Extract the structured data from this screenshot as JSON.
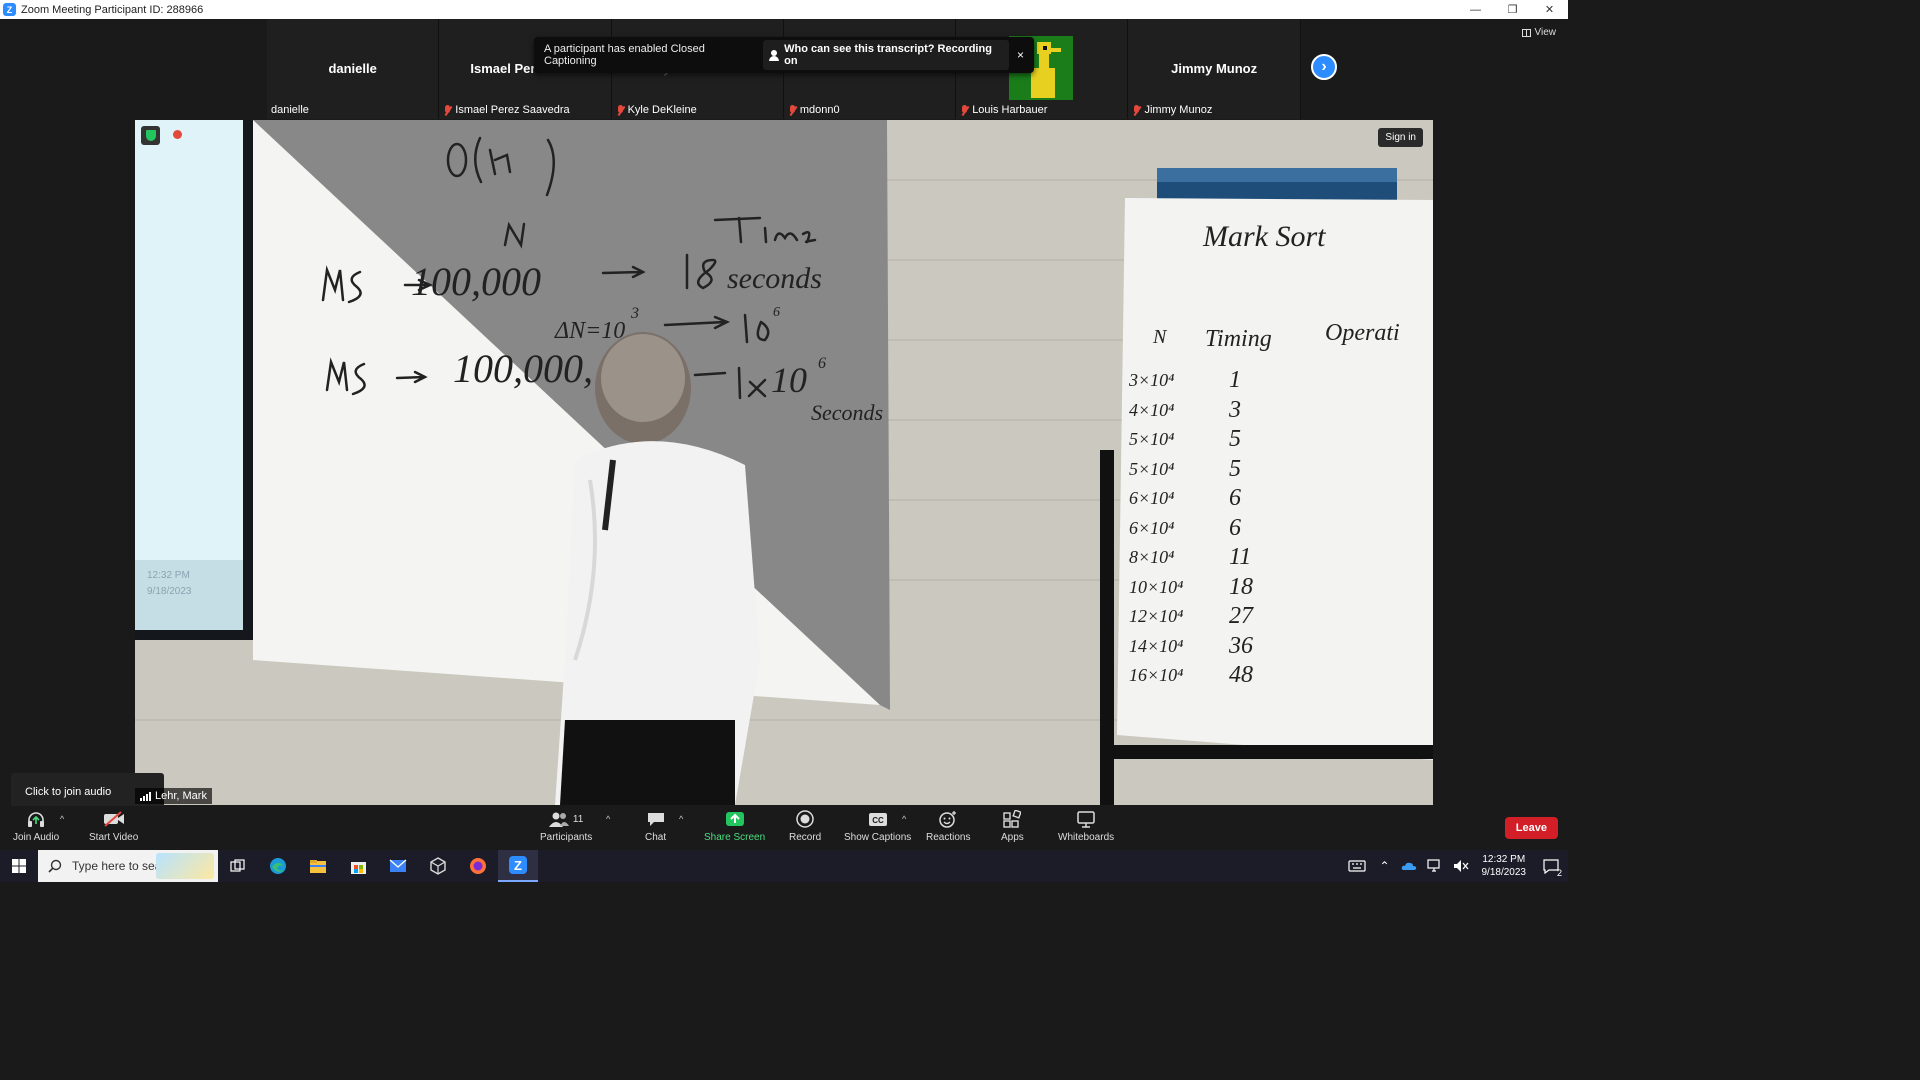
{
  "window": {
    "title": "Zoom Meeting Participant ID: 288966",
    "logo": "Z"
  },
  "view_button": "View",
  "gallery": [
    {
      "big_name": "danielle",
      "label": "danielle",
      "muted": false,
      "faded": false
    },
    {
      "big_name": "Ismael Perez Sa...",
      "label": "Ismael Perez Saavedra",
      "muted": true,
      "faded": false
    },
    {
      "big_name": "Kyle DeKleine",
      "label": "Kyle DeKleine",
      "muted": true,
      "faded": true
    },
    {
      "big_name": "mdonn0",
      "label": "mdonn0",
      "muted": true,
      "faded": true
    },
    {
      "big_name": "",
      "label": "Louis Harbauer",
      "muted": true,
      "faded": false
    },
    {
      "big_name": "Jimmy Munoz",
      "label": "Jimmy Munoz",
      "muted": true,
      "faded": false
    }
  ],
  "cc_banner": {
    "text": "A participant has enabled Closed Captioning",
    "link": "Who can see this transcript? Recording on",
    "close": "×"
  },
  "video": {
    "sign_in": "Sign in",
    "speaker": "Lehr, Mark",
    "board": {
      "big_o": "O(n²)",
      "col_n": "N",
      "col_time": "Time",
      "row1": "MS → 100,000 → 18 seconds",
      "row1_note": "ΔN = 10³ → 10⁶",
      "row2": "MS → 100,000,… → 18 × 10⁶ Seconds"
    },
    "side_board": {
      "title": "Mark Sort",
      "headers": [
        "N",
        "Timing",
        "Operati"
      ],
      "rows": [
        [
          "3×10⁴",
          "1"
        ],
        [
          "4×10⁴",
          "3"
        ],
        [
          "5×10⁴",
          "5"
        ],
        [
          "5×10⁴",
          "5"
        ],
        [
          "6×10⁴",
          "6"
        ],
        [
          "6×10⁴",
          "6"
        ],
        [
          "8×10⁴",
          "11"
        ],
        [
          "10×10⁴",
          "18"
        ],
        [
          "12×10⁴",
          "27"
        ],
        [
          "14×10⁴",
          "36"
        ],
        [
          "16×10⁴",
          "48"
        ]
      ]
    },
    "screen_time": "12:32 PM",
    "screen_date": "9/18/2023"
  },
  "join_tooltip": "Click to join audio",
  "toolbar": {
    "join_audio": "Join Audio",
    "start_video": "Start Video",
    "participants": "Participants",
    "participants_count": "11",
    "chat": "Chat",
    "share_screen": "Share Screen",
    "record": "Record",
    "show_captions": "Show Captions",
    "reactions": "Reactions",
    "apps": "Apps",
    "whiteboards": "Whiteboards",
    "leave": "Leave"
  },
  "taskbar": {
    "search_placeholder": "Type here to search",
    "time": "12:32 PM",
    "date": "9/18/2023",
    "notifications": "2"
  }
}
